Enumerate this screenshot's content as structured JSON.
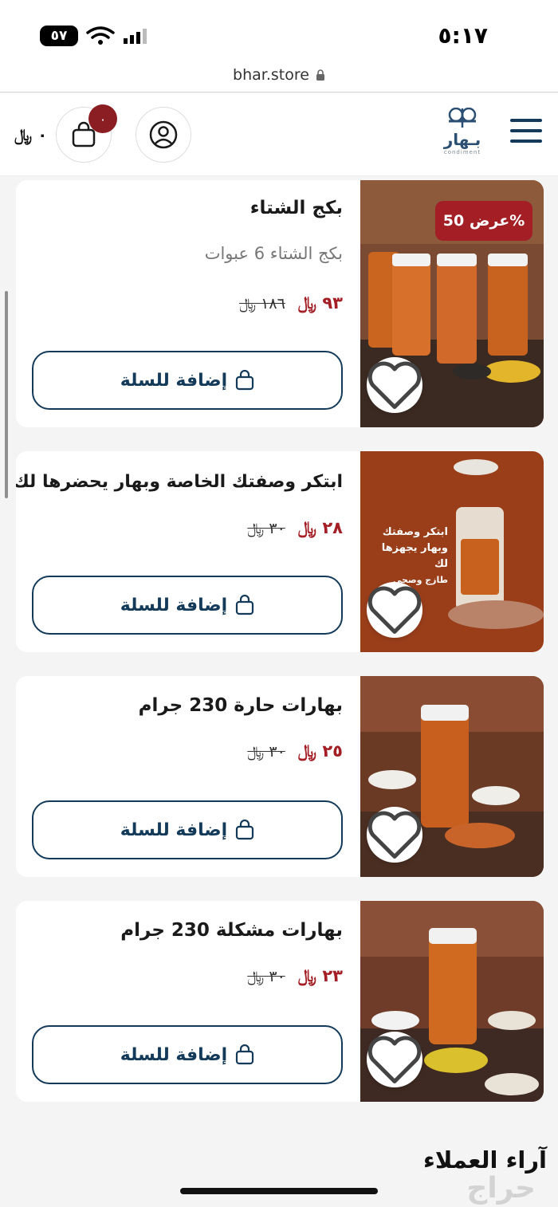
{
  "status_bar": {
    "time": "٥:١٧",
    "battery": "٥٧"
  },
  "browser": {
    "url": "bhar.store"
  },
  "header": {
    "logo_text": "بـهار",
    "logo_sub": "condiment",
    "cart_count": "٠",
    "cart_total": "٠ ﷼"
  },
  "products": [
    {
      "name": "بكج الشتاء",
      "description": "بكج الشتاء 6 عبوات",
      "price_new": "٩٣ ﷼",
      "price_old": "١٨٦ ﷼",
      "badge": "عرض 50%",
      "add_label": "إضافة للسلة"
    },
    {
      "name": "ابتكر وصفتك الخاصة وبهار يحضرها لك",
      "price_new": "٢٨ ﷼",
      "price_old": "٣٠ ﷼",
      "add_label": "إضافة للسلة",
      "image_text": [
        "ابتكر وصفتك",
        "وبهار يجهزها لك",
        "طازج وصحي"
      ]
    },
    {
      "name": "بهارات حارة 230 جرام",
      "price_new": "٢٥ ﷼",
      "price_old": "٣٠ ﷼",
      "add_label": "إضافة للسلة"
    },
    {
      "name": "بهارات مشكلة 230 جرام",
      "price_new": "٢٣ ﷼",
      "price_old": "٣٠ ﷼",
      "add_label": "إضافة للسلة"
    }
  ],
  "reviews_title": "آراء العملاء",
  "watermark": "حراج",
  "colors": {
    "brand": "#143a5a",
    "accent": "#a31f25",
    "background": "#f4f4f5"
  },
  "icons": [
    "wifi-icon",
    "signal-icon",
    "lock-icon",
    "menu-icon",
    "user-icon",
    "cart-icon",
    "heart-icon",
    "bag-icon"
  ]
}
